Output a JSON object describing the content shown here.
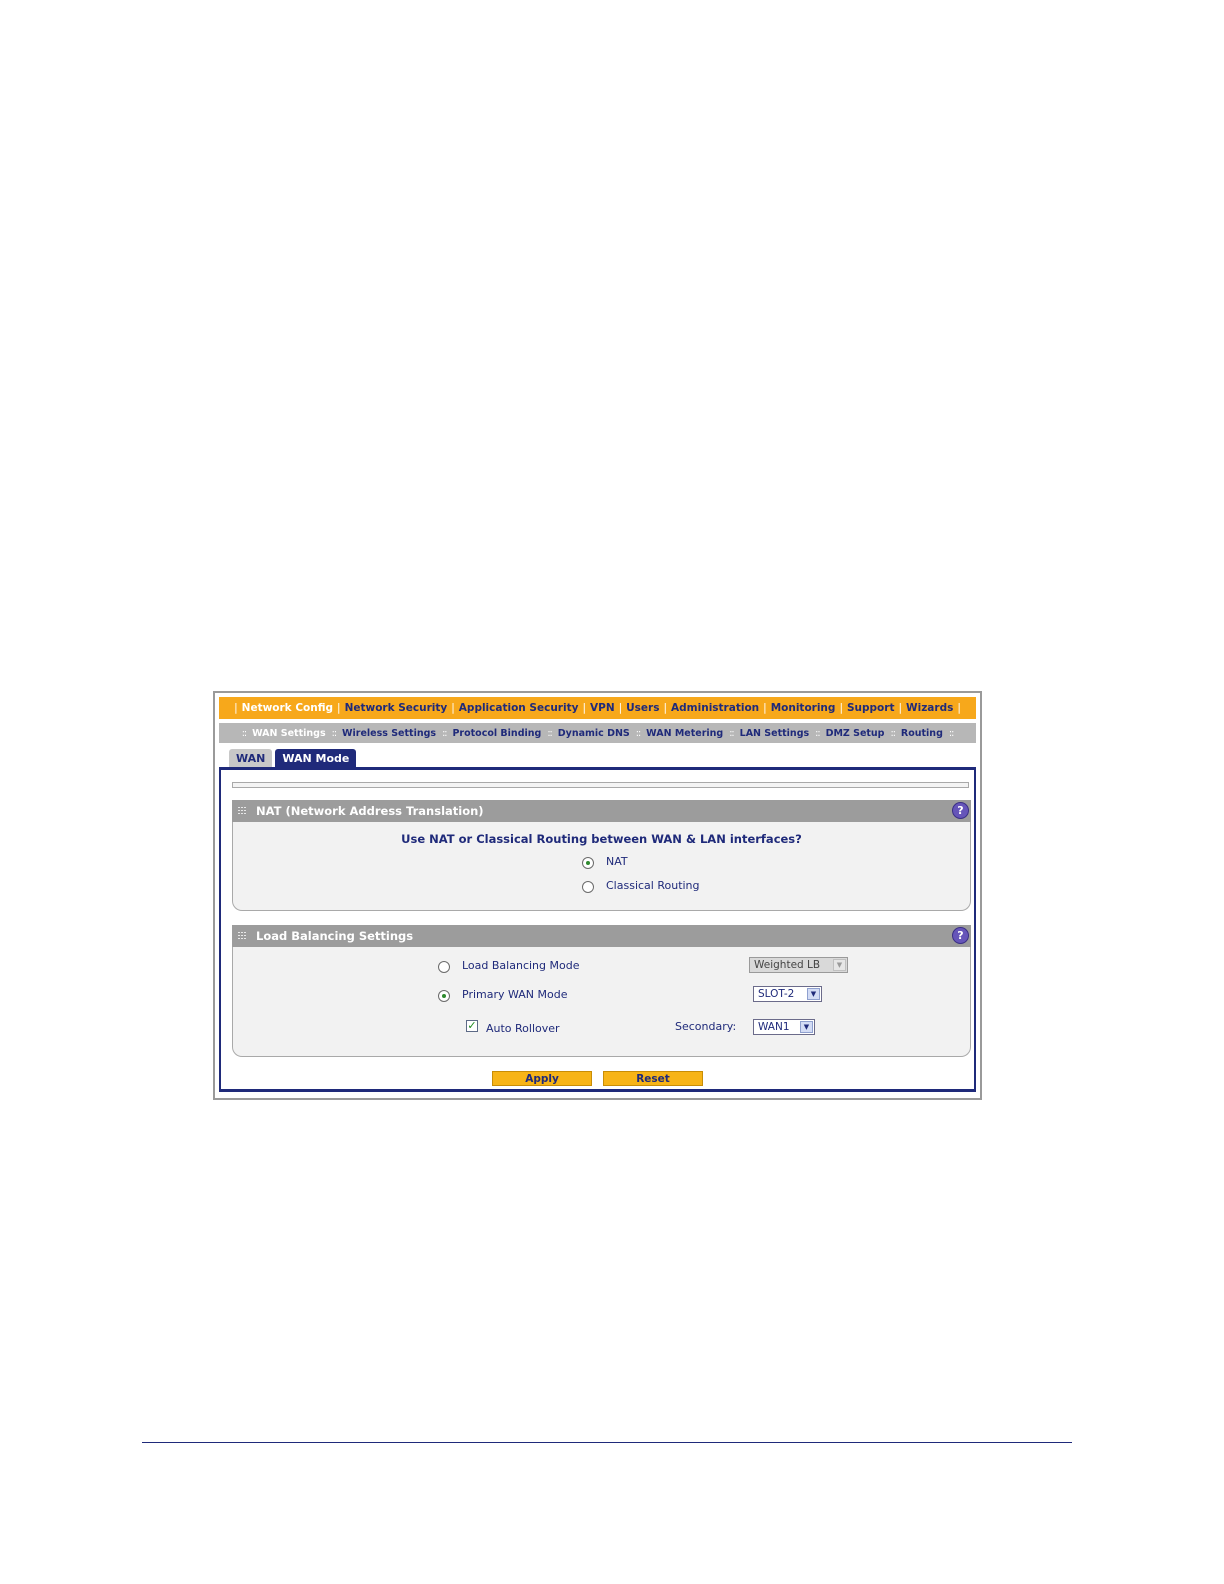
{
  "top_nav": {
    "items": [
      {
        "label": "Network Config",
        "active": true
      },
      {
        "label": "Network Security",
        "active": false
      },
      {
        "label": "Application Security",
        "active": false
      },
      {
        "label": "VPN",
        "active": false
      },
      {
        "label": "Users",
        "active": false
      },
      {
        "label": "Administration",
        "active": false
      },
      {
        "label": "Monitoring",
        "active": false
      },
      {
        "label": "Support",
        "active": false
      },
      {
        "label": "Wizards",
        "active": false
      }
    ],
    "separator": "|"
  },
  "sub_nav": {
    "items": [
      {
        "label": "WAN Settings",
        "active": true
      },
      {
        "label": "Wireless Settings",
        "active": false
      },
      {
        "label": "Protocol Binding",
        "active": false
      },
      {
        "label": "Dynamic DNS",
        "active": false
      },
      {
        "label": "WAN Metering",
        "active": false
      },
      {
        "label": "LAN Settings",
        "active": false
      },
      {
        "label": "DMZ Setup",
        "active": false
      },
      {
        "label": "Routing",
        "active": false
      }
    ],
    "separator": "::"
  },
  "tabs": [
    {
      "label": "WAN",
      "active": false
    },
    {
      "label": "WAN Mode",
      "active": true
    }
  ],
  "nat_section": {
    "title": "NAT (Network Address Translation)",
    "question": "Use NAT or Classical Routing between WAN & LAN interfaces?",
    "options": [
      {
        "label": "NAT",
        "selected": true
      },
      {
        "label": "Classical Routing",
        "selected": false
      }
    ],
    "help": "?"
  },
  "lb_section": {
    "title": "Load Balancing Settings",
    "help": "?",
    "load_balancing_mode": {
      "label": "Load Balancing Mode",
      "selected": false,
      "select_value": "Weighted LB",
      "select_disabled": true
    },
    "primary_wan_mode": {
      "label": "Primary WAN Mode",
      "selected": true,
      "select_value": "SLOT-2"
    },
    "auto_rollover": {
      "label": "Auto Rollover",
      "checked": true,
      "secondary_label": "Secondary:",
      "secondary_value": "WAN1"
    }
  },
  "buttons": {
    "apply": "Apply",
    "reset": "Reset"
  },
  "icons": {
    "check": "✓",
    "arrow": "▼"
  },
  "colors": {
    "nav_orange": "#f7a81b",
    "navy": "#1f2a7a",
    "section_gray": "#9c9c9c",
    "button_yellow": "#f7b417"
  }
}
